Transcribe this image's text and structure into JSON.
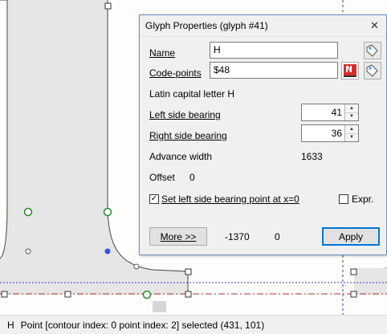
{
  "dialog": {
    "title": "Glyph Properties (glyph #41)",
    "close_icon": "close-icon",
    "name_label": "Name",
    "name_value": "H",
    "codepoints_label": "Code-points",
    "codepoints_value": "$48",
    "char_description": "Latin capital letter H",
    "lsb_label": "Left side bearing",
    "lsb_value": "41",
    "rsb_label": "Right side bearing",
    "rsb_value": "36",
    "advance_label": "Advance width",
    "advance_value": "1633",
    "offset_label": "Offset",
    "offset_value": "0",
    "set_lsb_label": "Set left side bearing point at x=0",
    "set_lsb_checked": true,
    "expr_label": "Expr.",
    "expr_checked": false,
    "more_button": "More >>",
    "coord_x": "-1370",
    "coord_y": "0",
    "apply_button": "Apply"
  },
  "statusbar": {
    "glyph_char": "H",
    "text": "Point [contour index: 0 point index: 2] selected (431, 101)"
  },
  "colors": {
    "glyph_fill": "#e6e6e6",
    "guide_blue": "#3a3ac8",
    "guide_red": "#b03030",
    "node_green": "#2a8a2a",
    "selected_point": "#3355dd"
  }
}
